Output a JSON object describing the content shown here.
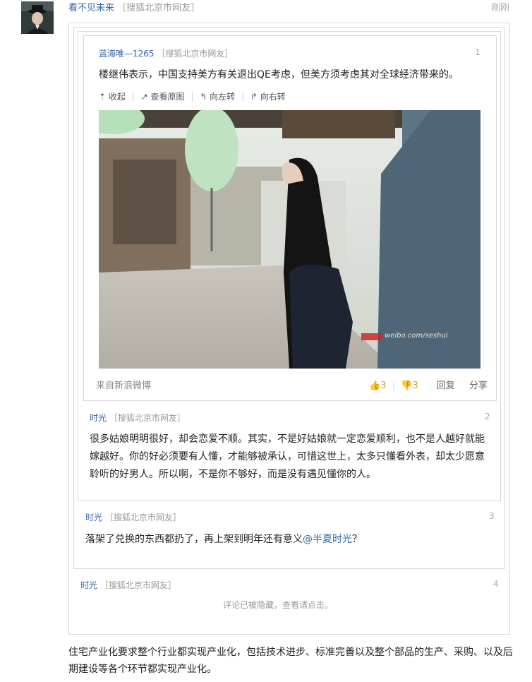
{
  "post": {
    "author": "看不见未来",
    "source": "［搜狐北京市网友］",
    "time": "刚刚"
  },
  "floor1": {
    "author": "蓝海唯—1265",
    "source": "［搜狐北京市网友］",
    "num": "1",
    "text": "楼继伟表示，中国支持美方有关退出QE考虑，但美方须考虑其对全球经济带来的。",
    "toolbar": {
      "collapse": "收起",
      "view_original": "查看原图",
      "rotate_left": "向左转",
      "rotate_right": "向右转"
    },
    "photo_watermark": "weibo.com/seshui",
    "from": "来自新浪微博",
    "likes": "3",
    "dislikes": "3",
    "reply": "回复",
    "share": "分享"
  },
  "floor2": {
    "author": "时光",
    "source": "［搜狐北京市网友］",
    "num": "2",
    "text": "很多姑娘明明很好，却会恋爱不顺。其实，不是好姑娘就一定恋爱顺利，也不是人越好就能嫁越好。你的好必须要有人懂，才能够被承认，可惜这世上，太多只懂看外表，却太少愿意聆听的好男人。所以啊，不是你不够好，而是没有遇见懂你的人。"
  },
  "floor3": {
    "author": "时光",
    "source": "［搜狐北京市网友］",
    "num": "3",
    "text_before": "落架了兑换的东西都扔了，再上架到明年还有意义",
    "mention": "@半夏时光",
    "text_after": "？"
  },
  "floor4": {
    "author": "时光",
    "source": "［搜狐北京市网友］",
    "num": "4",
    "hidden_notice": "评论已被隐藏，查看请点击。"
  },
  "main_text": "住宅产业化要求整个行业都实现产业化，包括技术进步、标准完善以及整个部品的生产、采购、以及后期建设等各个环节都实现产业化。",
  "colors": {
    "link": "#3366aa",
    "source": "#999999",
    "border": "#d8d8d8",
    "badge": "#e0a040"
  }
}
